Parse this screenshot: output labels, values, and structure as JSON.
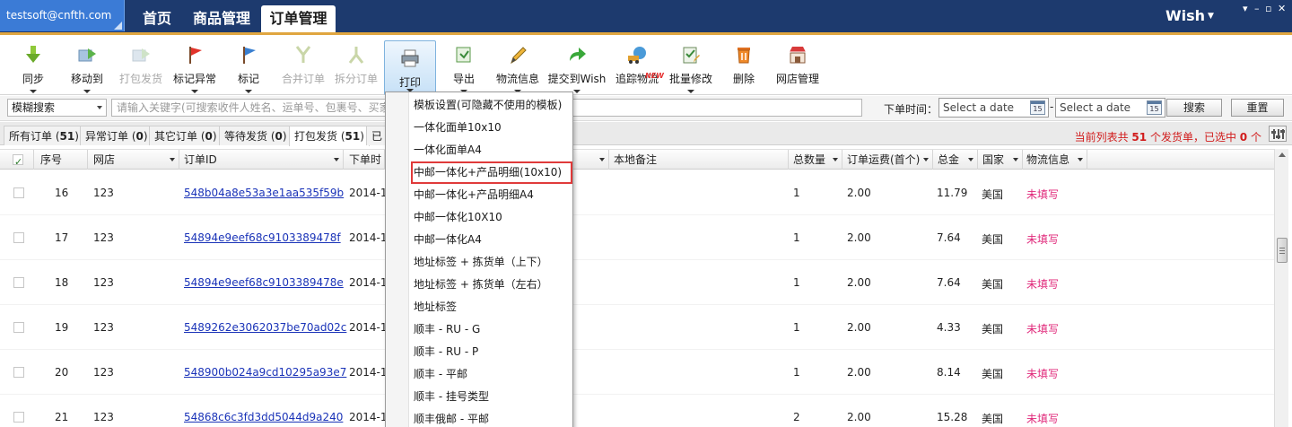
{
  "titlebar": {
    "account": "testsoft@cnfth.com",
    "nav": [
      "首页",
      "商品管理",
      "订单管理"
    ],
    "store": "Wish",
    "controls": [
      "▾",
      "–",
      "▫",
      "✕"
    ]
  },
  "toolbar": {
    "sync": "同步",
    "move_to": "移动到",
    "pack_ship": "打包发货",
    "mark_exception": "标记异常",
    "mark": "标记",
    "merge_order": "合并订单",
    "split_order": "拆分订单",
    "print": "打印",
    "export": "导出",
    "logistics": "物流信息",
    "submit_wish": "提交到Wish",
    "track": "追踪物流",
    "batch_edit": "批量修改",
    "delete": "删除",
    "store_manage": "网店管理",
    "new_badge": "NEW"
  },
  "search": {
    "mode": "模糊搜索",
    "placeholder": "请输入关键字(可搜索收件人姓名、运单号、包裹号、买家",
    "date_label": "下单时间：",
    "date_from": "Select a date",
    "date_to": "Select a date",
    "date_sep": "-",
    "calendar_day": "15",
    "search_btn": "搜索",
    "reset_btn": "重置"
  },
  "tabs": [
    {
      "label": "所有订单",
      "count": "51"
    },
    {
      "label": "异常订单",
      "count": "0"
    },
    {
      "label": "其它订单",
      "count": "0"
    },
    {
      "label": "等待发货",
      "count": "0"
    },
    {
      "label": "打包发货",
      "count": "51"
    },
    {
      "label": "已",
      "count": ""
    }
  ],
  "summary": {
    "prefix": "当前列表共",
    "total": "51",
    "mid": "个发货单，已选中",
    "selected": "0",
    "suffix": "个"
  },
  "table": {
    "headers": {
      "seq": "序号",
      "store": "网店",
      "order_id": "订单ID",
      "order_time": "下单时",
      "local_note": "本地备注",
      "qty": "总数量",
      "freight": "订单运费(首个)",
      "total": "总金",
      "country": "国家",
      "logistics": "物流信息"
    },
    "rows": [
      {
        "seq": "16",
        "store": "123",
        "order_id": "548b04a8e53a3e1aa535f59b",
        "time": "2014-1",
        "qty": "1",
        "freight": "2.00",
        "total": "11.79",
        "country": "美国",
        "logistics": "未填写"
      },
      {
        "seq": "17",
        "store": "123",
        "order_id": "54894e9eef68c9103389478f",
        "time": "2014-1",
        "qty": "1",
        "freight": "2.00",
        "total": "7.64",
        "country": "美国",
        "logistics": "未填写"
      },
      {
        "seq": "18",
        "store": "123",
        "order_id": "54894e9eef68c9103389478e",
        "time": "2014-1",
        "qty": "1",
        "freight": "2.00",
        "total": "7.64",
        "country": "美国",
        "logistics": "未填写"
      },
      {
        "seq": "19",
        "store": "123",
        "order_id": "5489262e3062037be70ad02c",
        "time": "2014-1",
        "qty": "1",
        "freight": "2.00",
        "total": "4.33",
        "country": "美国",
        "logistics": "未填写"
      },
      {
        "seq": "20",
        "store": "123",
        "order_id": "548900b024a9cd10295a93e7",
        "time": "2014-1",
        "qty": "1",
        "freight": "2.00",
        "total": "8.14",
        "country": "美国",
        "logistics": "未填写"
      },
      {
        "seq": "21",
        "store": "123",
        "order_id": "54868c6c3fd3dd5044d9a240",
        "time": "2014-1",
        "qty": "2",
        "freight": "2.00",
        "total": "15.28",
        "country": "美国",
        "logistics": "未填写"
      }
    ]
  },
  "print_menu": [
    "模板设置(可隐藏不使用的模板)",
    "一体化面单10x10",
    "一体化面单A4",
    "中邮一体化+产品明细(10x10)",
    "中邮一体化+产品明细A4",
    "中邮一体化10X10",
    "中邮一体化A4",
    "地址标签 + 拣货单（上下）",
    "地址标签 + 拣货单（左右）",
    "地址标签",
    "顺丰 - RU - G",
    "顺丰 - RU - P",
    "顺丰 - 平邮",
    "顺丰 - 挂号类型",
    "顺丰俄邮 - 平邮"
  ],
  "colors": {
    "titlebar": "#1d3a6e",
    "accent": "#e0a640",
    "link": "#1a33b8",
    "warning": "#e0287a",
    "highlight": "#e03a3a"
  }
}
